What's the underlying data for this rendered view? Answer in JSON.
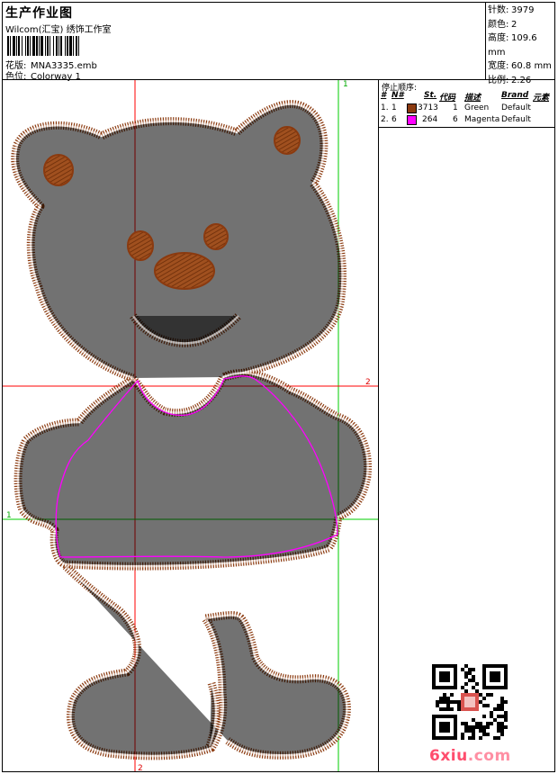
{
  "header": {
    "title": "生产作业图",
    "software": "Wilcom(汇宝) 绣饰工作室",
    "design_label": "花版:",
    "design_value": "MNA3335.emb",
    "colorway_label": "色位:",
    "colorway_value": "Colorway 1"
  },
  "stats": [
    {
      "label": "针数:",
      "value": "3979"
    },
    {
      "label": "颜色:",
      "value": "2"
    },
    {
      "label": "高度:",
      "value": "109.6 mm"
    },
    {
      "label": "宽度:",
      "value": "60.8 mm"
    },
    {
      "label": "比例:",
      "value": "2.26"
    }
  ],
  "sequence": {
    "title": "停止顺序:",
    "headers": {
      "idx": "#",
      "needle": "N#",
      "stitches": "St.",
      "code": "代码",
      "desc": "描述",
      "brand": "Brand",
      "elements": "元素"
    },
    "rows": [
      {
        "idx": "1.",
        "needle": "1",
        "swatch": "#8b3a0f",
        "stitches": "3713",
        "code": "1",
        "desc": "Green",
        "brand": "Default"
      },
      {
        "idx": "2.",
        "needle": "6",
        "swatch": "#ff00ff",
        "stitches": "264",
        "code": "6",
        "desc": "Magenta",
        "brand": "Default"
      }
    ]
  },
  "guides": {
    "v_green_label": "1",
    "h_red_label": "2",
    "h_green_label": "1",
    "v_red_label": "2"
  },
  "colors": {
    "stitch": "#8b3a0f",
    "outline": "#ff00ff",
    "guide_red": "#ff0000",
    "guide_green": "#00cc00"
  },
  "icons": {
    "qr": "qr-code-icon"
  },
  "watermark": {
    "name": "6xiu",
    "tld": ".com"
  }
}
